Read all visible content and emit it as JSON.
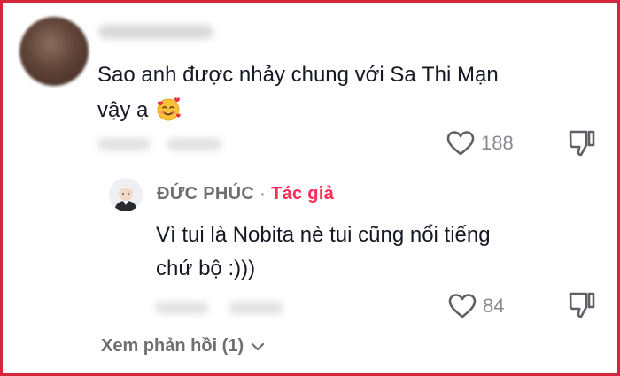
{
  "comment": {
    "text_line1": "Sao anh được nhảy chung với Sa Thi Mạn",
    "text_line2": "vậy ạ",
    "emoji": "smiling-face-with-hearts",
    "like_count": "188"
  },
  "reply": {
    "author_name": "ĐỨC PHÚC",
    "separator": "·",
    "author_badge": "Tác giả",
    "text_line1": "Vì tui là Nobita nè tui cũng nổi tiếng",
    "text_line2": "chứ bộ :)))",
    "like_count": "84"
  },
  "view_replies": {
    "label": "Xem phản hồi (1)"
  },
  "colors": {
    "frame_border": "#d6243a",
    "author_badge": "#fe2c55",
    "muted_text": "#8a8b91"
  }
}
